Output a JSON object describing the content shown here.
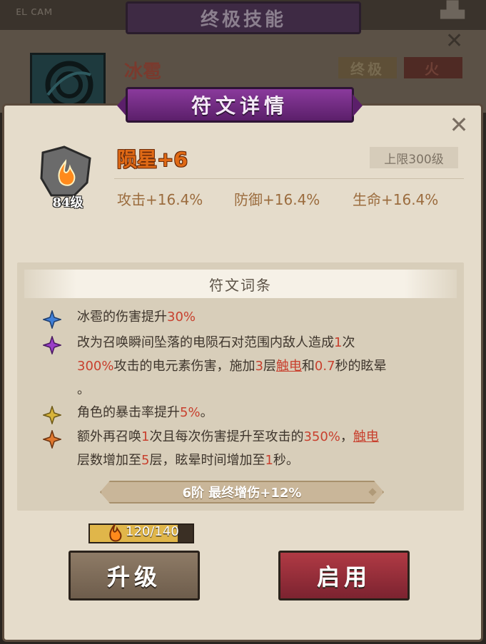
{
  "background_panel": {
    "corner_left": "ᴇʟ ᴄᴀᴍ",
    "corner_right": "▟▙",
    "banner_title": "终极技能",
    "skill_name": "冰雹",
    "tags": [
      "终极",
      "火"
    ],
    "close_glyph": "✕"
  },
  "rune_panel": {
    "banner_title": "符文详情",
    "close_glyph": "✕",
    "rune": {
      "name": "陨星+6",
      "level": "84级",
      "level_cap": "上限300级",
      "stats": {
        "attack": "攻击+16.4%",
        "defense": "防御+16.4%",
        "hp": "生命+16.4%"
      }
    },
    "entries_title": "符文词条",
    "entries": [
      {
        "gem_color": "#3f7fd8",
        "parts": [
          "冰雹的伤害提升",
          "30%"
        ]
      },
      {
        "gem_color": "#9a3fc8",
        "parts": [
          "改为召唤瞬间坠落的电陨石对范围内敌人造成",
          "1",
          "次",
          "300%",
          "攻击的电元素伤害，施加",
          "3",
          "层",
          "触电",
          "和",
          "0.7",
          "秒的眩晕",
          "。"
        ]
      },
      {
        "gem_color": "#d8b43a",
        "parts": [
          "角色的暴击率提升",
          "5%",
          "。"
        ]
      },
      {
        "gem_color": "#e0782e",
        "parts": [
          "额外再召唤",
          "1",
          "次且每次伤害提升至攻击的",
          "350%",
          "，",
          "触电",
          "层数增加至",
          "5",
          "层，眩晕时间增加至",
          "1",
          "秒。"
        ]
      }
    ],
    "tier_bonus": "6阶 最终增伤+12%",
    "material": {
      "count": "120/140",
      "progress": 0.857
    },
    "buttons": {
      "upgrade": "升级",
      "enable": "启用"
    }
  },
  "colors": {
    "accent_purple": "#8a3a9c",
    "rune_name_orange": "#e06a16",
    "highlight_red": "#c8402e",
    "enable_button": "#b03a44",
    "upgrade_button": "#8e7b66"
  }
}
